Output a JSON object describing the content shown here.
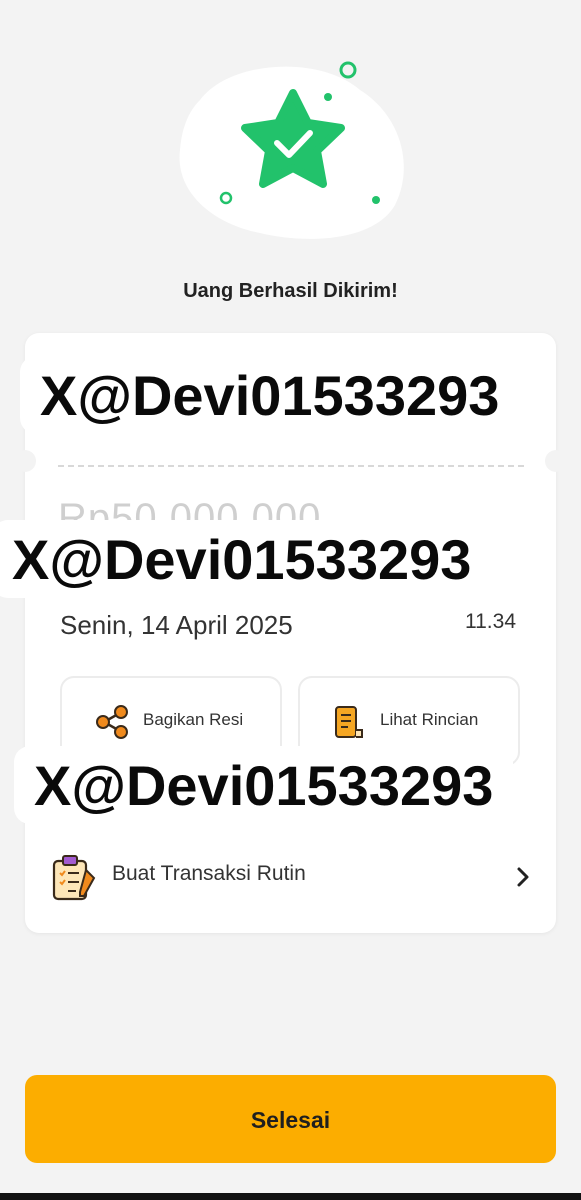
{
  "status": {
    "title": "Uang Berhasil Dikirim!"
  },
  "transaction": {
    "amount_partial": "Rp50.000.000",
    "sub_partial": "...",
    "date": "Senin, 14 April 2025",
    "time": "11.34"
  },
  "actions": {
    "share_label": "Bagikan Resi",
    "detail_label": "Lihat Rincian"
  },
  "routine": {
    "label": "Buat Transaksi Rutin"
  },
  "watermarks": [
    "X@Devi01533293",
    "X@Devi01533293",
    "X@Devi01533293"
  ],
  "footer": {
    "done_label": "Selesai"
  },
  "icons": {
    "success": "star-check-icon",
    "share": "share-icon",
    "detail": "receipt-icon",
    "routine": "clipboard-icon",
    "chevron": "chevron-right-icon"
  },
  "colors": {
    "accent_green": "#22c26b",
    "cta_yellow": "#fcad00",
    "share_orange": "#f08a1d",
    "background": "#f3f3f3"
  }
}
